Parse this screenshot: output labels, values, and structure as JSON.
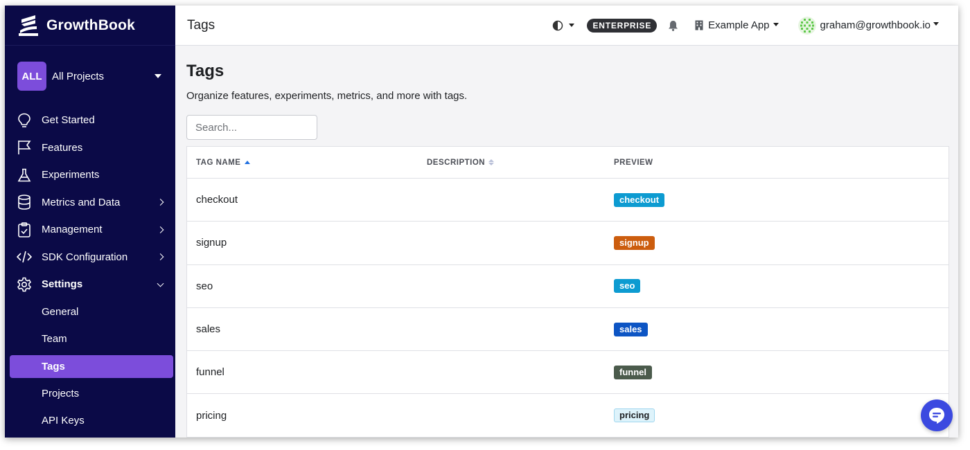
{
  "brand": {
    "name": "GrowthBook"
  },
  "project": {
    "badge": "ALL",
    "name": "All Projects"
  },
  "sidebar": {
    "items": [
      {
        "label": "Get Started",
        "icon": "lightbulb-icon"
      },
      {
        "label": "Features",
        "icon": "flag-icon"
      },
      {
        "label": "Experiments",
        "icon": "flask-icon"
      },
      {
        "label": "Metrics and Data",
        "icon": "database-icon"
      },
      {
        "label": "Management",
        "icon": "clipboard-icon"
      },
      {
        "label": "SDK Configuration",
        "icon": "code-icon"
      },
      {
        "label": "Settings",
        "icon": "gear-icon"
      }
    ],
    "settings_sub": [
      {
        "label": "General"
      },
      {
        "label": "Team"
      },
      {
        "label": "Tags"
      },
      {
        "label": "Projects"
      },
      {
        "label": "API Keys"
      }
    ]
  },
  "topbar": {
    "title": "Tags",
    "plan_badge": "ENTERPRISE",
    "org_name": "Example App",
    "user_email": "graham@growthbook.io"
  },
  "page": {
    "heading": "Tags",
    "description": "Organize features, experiments, metrics, and more with tags.",
    "search_placeholder": "Search..."
  },
  "table": {
    "headers": {
      "name": "TAG NAME",
      "description": "DESCRIPTION",
      "preview": "PREVIEW"
    },
    "rows": [
      {
        "name": "checkout",
        "description": "",
        "preview": "checkout",
        "color": "#0d9bd1",
        "text_color": "#ffffff"
      },
      {
        "name": "signup",
        "description": "",
        "preview": "signup",
        "color": "#cc5d0e",
        "text_color": "#ffffff"
      },
      {
        "name": "seo",
        "description": "",
        "preview": "seo",
        "color": "#0d9bd1",
        "text_color": "#ffffff"
      },
      {
        "name": "sales",
        "description": "",
        "preview": "sales",
        "color": "#0d55c4",
        "text_color": "#ffffff"
      },
      {
        "name": "funnel",
        "description": "",
        "preview": "funnel",
        "color": "#4b5b4c",
        "text_color": "#ffffff"
      },
      {
        "name": "pricing",
        "description": "",
        "preview": "pricing",
        "color": "#def3fb",
        "text_color": "#1d1f22"
      }
    ]
  },
  "colors": {
    "sidebar_bg": "#0b0a47",
    "accent": "#7c4ddb",
    "chat": "#3b49e0"
  }
}
